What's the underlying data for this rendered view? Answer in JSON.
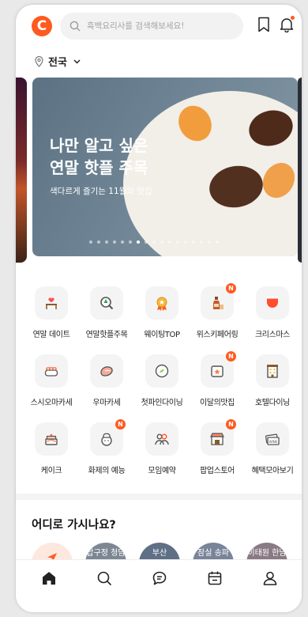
{
  "header": {
    "logo_letter": "C",
    "search_placeholder": "흑백요리사를 검색해보세요!"
  },
  "location": {
    "label": "전국"
  },
  "banner": {
    "title_line1": "나만 알고 싶은",
    "title_line2": "연말 핫플 주목",
    "subtitle": "색다르게 즐기는 11월의 맛집",
    "page_count": 17,
    "active_index": 6
  },
  "categories": [
    {
      "label": "연말 데이트",
      "icon": "heart-table-icon",
      "badge": ""
    },
    {
      "label": "연말핫플주목",
      "icon": "magnifier-tree-icon",
      "badge": ""
    },
    {
      "label": "웨이팅TOP",
      "icon": "medal-icon",
      "badge": ""
    },
    {
      "label": "위스키페어링",
      "icon": "whisky-bottle-icon",
      "badge": "N"
    },
    {
      "label": "크리스마스",
      "icon": "christmas-icon",
      "badge": ""
    },
    {
      "label": "스시오마카세",
      "icon": "sushi-icon",
      "badge": ""
    },
    {
      "label": "우마카세",
      "icon": "steak-icon",
      "badge": ""
    },
    {
      "label": "첫파인다이닝",
      "icon": "fine-dining-plate-icon",
      "badge": ""
    },
    {
      "label": "이달의맛집",
      "icon": "calendar-star-icon",
      "badge": "N"
    },
    {
      "label": "호텔다이닝",
      "icon": "hotel-icon",
      "badge": ""
    },
    {
      "label": "케이크",
      "icon": "cake-icon",
      "badge": ""
    },
    {
      "label": "화제의 예능",
      "icon": "chef-icon",
      "badge": "N"
    },
    {
      "label": "모임예약",
      "icon": "group-icon",
      "badge": ""
    },
    {
      "label": "팝업스토어",
      "icon": "popup-store-icon",
      "badge": "N"
    },
    {
      "label": "혜택모아보기",
      "icon": "coupon-icon",
      "badge": ""
    }
  ],
  "section_where": {
    "title": "어디로 가시나요?"
  },
  "regions": [
    {
      "label": "",
      "icon": "location-arrow-icon"
    },
    {
      "label": "압구정 청담",
      "icon": ""
    },
    {
      "label": "부산",
      "icon": ""
    },
    {
      "label": "잠실 송파",
      "icon": ""
    },
    {
      "label": "이태원 한남",
      "icon": ""
    }
  ],
  "bottom_nav": [
    {
      "name": "home",
      "icon": "home-icon"
    },
    {
      "name": "search",
      "icon": "search-icon"
    },
    {
      "name": "chat",
      "icon": "chat-icon"
    },
    {
      "name": "calendar",
      "icon": "calendar-icon"
    },
    {
      "name": "my",
      "icon": "user-icon"
    }
  ],
  "colors": {
    "accent": "#ff5a1f",
    "tile_bg": "#f4f4f5"
  }
}
